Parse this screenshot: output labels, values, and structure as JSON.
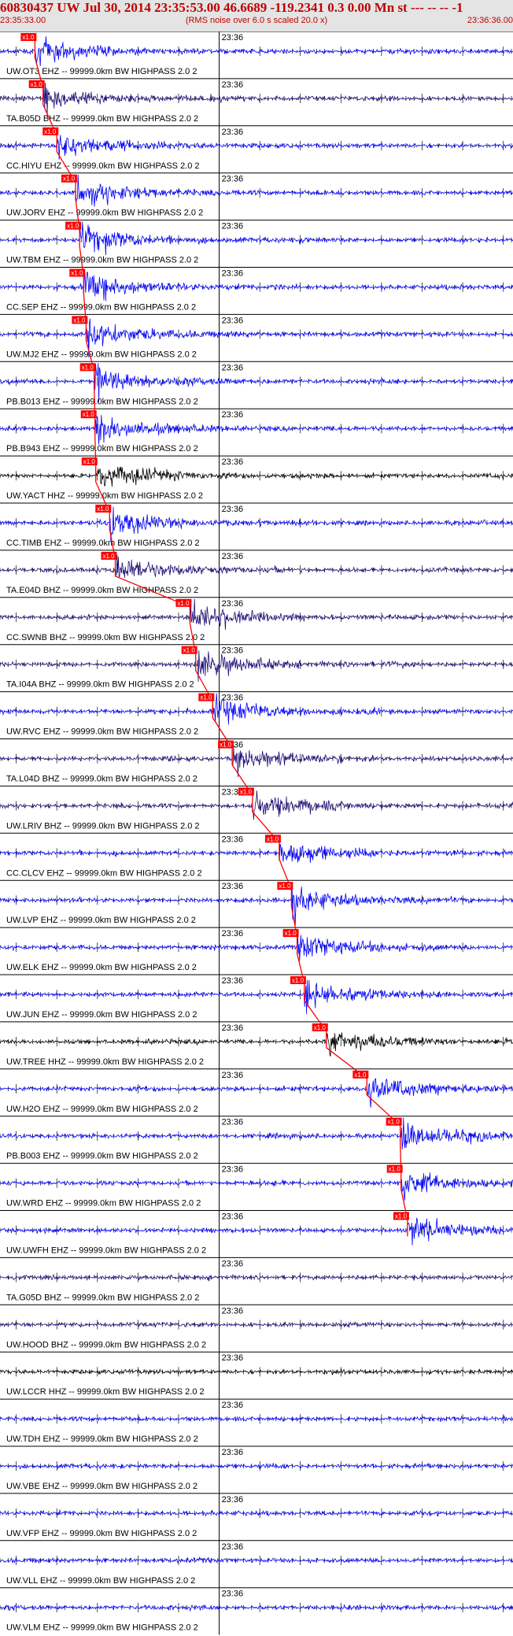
{
  "header": {
    "title": "60830437 UW Jul 30, 2014 23:35:53.00   46.6689 -119.2341  0.3 0.00 Mn st --- -- --  -1",
    "subtitle": "(RMS noise over 6.0 s scaled 20.0 x)",
    "time_start": "23:35:33.00",
    "time_end": "23:36:36.00"
  },
  "colors": {
    "header_text": "#c00000",
    "header_bg": "#e4e4e4",
    "pick": "#ff0000"
  },
  "chart_data": {
    "type": "line",
    "title": "60830437 UW Jul 30, 2014 23:35:53.00   46.6689 -119.2341  0.3 0.00 Mn st --- -- --  -1",
    "subtitle": "(RMS noise over 6.0 s scaled 20.0 x)",
    "x_range": [
      "23:35:33.00",
      "23:36:36.00"
    ],
    "minute_mark_label": "23:36",
    "minute_mark_time": "23:36:00.00",
    "pick_label": "x1.0",
    "traces": [
      {
        "label": "UW.OT3 EHZ -- 99999.0km BW  HIGHPASS  2.0  2",
        "color": "#0000ff",
        "pick_time": "23:35:37.3"
      },
      {
        "label": "TA.B05D BHZ -- 99999.0km BW  HIGHPASS  2.0  2",
        "color": "#1c0e7a",
        "pick_time": "23:35:38.3"
      },
      {
        "label": "CC.HIYU EHZ -- 99999.0km BW  HIGHPASS  2.0  2",
        "color": "#0000ff",
        "pick_time": "23:35:40.0"
      },
      {
        "label": "UW.JORV EHZ -- 99999.0km BW  HIGHPASS  2.0  2",
        "color": "#0000ff",
        "pick_time": "23:35:42.3"
      },
      {
        "label": "UW.TBM EHZ -- 99999.0km BW  HIGHPASS  2.0  2",
        "color": "#0000ff",
        "pick_time": "23:35:42.8"
      },
      {
        "label": "CC.SEP EHZ -- 99999.0km BW  HIGHPASS  2.0  2",
        "color": "#0000ff",
        "pick_time": "23:35:43.3"
      },
      {
        "label": "UW.MJ2 EHZ -- 99999.0km BW  HIGHPASS  2.0  2",
        "color": "#0000ff",
        "pick_time": "23:35:43.6"
      },
      {
        "label": "PB.B013 EHZ -- 99999.0km BW  HIGHPASS  2.0  2",
        "color": "#0000ff",
        "pick_time": "23:35:44.6"
      },
      {
        "label": "PB.B943 EHZ -- 99999.0km BW  HIGHPASS  2.0  2",
        "color": "#0000ff",
        "pick_time": "23:35:44.7"
      },
      {
        "label": "UW.YACT HHZ -- 99999.0km BW  HIGHPASS  2.0  2",
        "color": "#000000",
        "pick_time": "23:35:44.8"
      },
      {
        "label": "CC.TIMB EHZ -- 99999.0km BW  HIGHPASS  2.0  2",
        "color": "#0000ff",
        "pick_time": "23:35:46.5"
      },
      {
        "label": "TA.E04D BHZ -- 99999.0km BW  HIGHPASS  2.0  2",
        "color": "#1c0e7a",
        "pick_time": "23:35:47.2"
      },
      {
        "label": "CC.SWNB BHZ -- 99999.0km BW  HIGHPASS  2.0  2",
        "color": "#1c0e7a",
        "pick_time": "23:35:56.4"
      },
      {
        "label": "TA.I04A BHZ -- 99999.0km BW  HIGHPASS  2.0  2",
        "color": "#1c0e7a",
        "pick_time": "23:35:57.1"
      },
      {
        "label": "UW.RVC EHZ -- 99999.0km BW  HIGHPASS  2.0  2",
        "color": "#0000ff",
        "pick_time": "23:35:59.2"
      },
      {
        "label": "TA.L04D BHZ -- 99999.0km BW  HIGHPASS  2.0  2",
        "color": "#1c0e7a",
        "pick_time": "23:36:01.6"
      },
      {
        "label": "UW.LRIV BHZ -- 99999.0km BW  HIGHPASS  2.0  2",
        "color": "#1c0e7a",
        "pick_time": "23:36:04.1"
      },
      {
        "label": "CC.CLCV EHZ -- 99999.0km BW  HIGHPASS  2.0  2",
        "color": "#0000ff",
        "pick_time": "23:36:07.4"
      },
      {
        "label": "UW.LVP EHZ -- 99999.0km BW  HIGHPASS  2.0  2",
        "color": "#0000ff",
        "pick_time": "23:36:08.9"
      },
      {
        "label": "UW.ELK EHZ -- 99999.0km BW  HIGHPASS  2.0  2",
        "color": "#0000ff",
        "pick_time": "23:36:09.6"
      },
      {
        "label": "UW.JUN EHZ -- 99999.0km BW  HIGHPASS  2.0  2",
        "color": "#0000ff",
        "pick_time": "23:36:10.5"
      },
      {
        "label": "UW.TREE HHZ -- 99999.0km BW  HIGHPASS  2.0  2",
        "color": "#000000",
        "pick_time": "23:36:13.2"
      },
      {
        "label": "UW.H2O EHZ -- 99999.0km BW  HIGHPASS  2.0  2",
        "color": "#0000ff",
        "pick_time": "23:36:18.2"
      },
      {
        "label": "PB.B003 EHZ -- 99999.0km BW  HIGHPASS  2.0  2",
        "color": "#0000ff",
        "pick_time": "23:36:22.3"
      },
      {
        "label": "UW.WRD EHZ -- 99999.0km BW  HIGHPASS  2.0  2",
        "color": "#0000ff",
        "pick_time": "23:36:22.4"
      },
      {
        "label": "UW.UWFH EHZ -- 99999.0km BW  HIGHPASS  2.0  2",
        "color": "#0000ff",
        "pick_time": "23:36:23.2"
      },
      {
        "label": "TA.G05D BHZ -- 99999.0km BW  HIGHPASS  2.0  2",
        "color": "#1c0e7a",
        "pick_time": null
      },
      {
        "label": "UW.HOOD BHZ -- 99999.0km BW  HIGHPASS  2.0  2",
        "color": "#1c0e7a",
        "pick_time": null
      },
      {
        "label": "UW.LCCR HHZ -- 99999.0km BW  HIGHPASS  2.0  2",
        "color": "#000000",
        "pick_time": null
      },
      {
        "label": "UW.TDH EHZ -- 99999.0km BW  HIGHPASS  2.0  2",
        "color": "#0000ff",
        "pick_time": null
      },
      {
        "label": "UW.VBE EHZ -- 99999.0km BW  HIGHPASS  2.0  2",
        "color": "#0000ff",
        "pick_time": null
      },
      {
        "label": "UW.VFP EHZ -- 99999.0km BW  HIGHPASS  2.0  2",
        "color": "#0000ff",
        "pick_time": null
      },
      {
        "label": "UW.VLL EHZ -- 99999.0km BW  HIGHPASS  2.0  2",
        "color": "#0000ff",
        "pick_time": null
      },
      {
        "label": "UW.VLM EHZ -- 99999.0km BW  HIGHPASS  2.0  2",
        "color": "#0000ff",
        "pick_time": null
      }
    ]
  }
}
